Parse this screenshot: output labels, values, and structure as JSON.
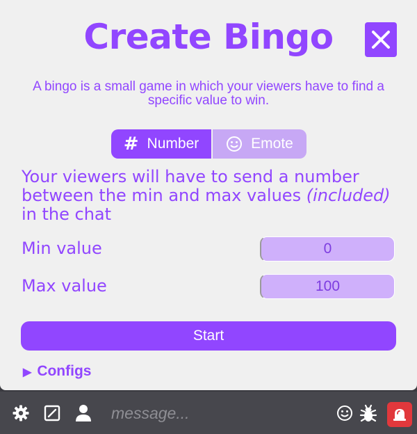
{
  "dialog": {
    "title": "Create Bingo",
    "description": "A bingo is a small game in which your viewers have to find a specific value to win.",
    "close_icon": "close-icon",
    "accent_color": "#9146ff"
  },
  "mode_switch": {
    "number_label": "Number",
    "number_icon": "hash-icon",
    "emote_label": "Emote",
    "emote_icon": "smiley-icon",
    "selected": "Number"
  },
  "explanation": {
    "line1": "Your viewers will have to send a number between the min and max values",
    "italic": "(included)",
    "line2": " in the chat"
  },
  "fields": {
    "min_label": "Min value",
    "min_value": "0",
    "max_label": "Max value",
    "max_value": "100"
  },
  "start_label": "Start",
  "configs_label": "Configs",
  "bottom_bar": {
    "icons": [
      "gear-icon",
      "edit-icon",
      "user-icon",
      "smiley-icon",
      "bug-icon",
      "alert-icon"
    ],
    "message_placeholder": "message..."
  }
}
